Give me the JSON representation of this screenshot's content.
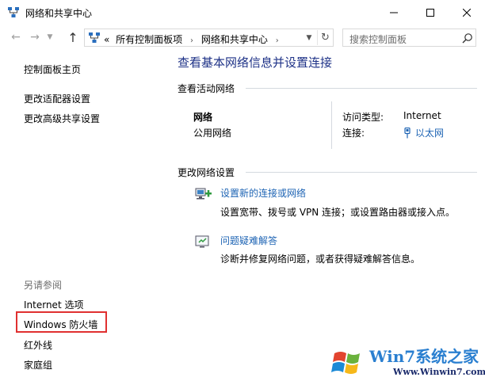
{
  "window": {
    "title": "网络和共享中心"
  },
  "address_bar": {
    "overflow": "«",
    "crumbs": [
      "所有控制面板项",
      "网络和共享中心"
    ],
    "search_placeholder": "搜索控制面板"
  },
  "left_pane": {
    "links": [
      "控制面板主页",
      "更改适配器设置",
      "更改高级共享设置"
    ],
    "see_also_header": "另请参阅",
    "see_also_links": [
      "Internet 选项",
      "Windows 防火墙",
      "红外线",
      "家庭组"
    ]
  },
  "main": {
    "title": "查看基本网络信息并设置连接",
    "active_networks": {
      "header": "查看活动网络",
      "network_name": "网络",
      "network_type": "公用网络",
      "access_type_label": "访问类型:",
      "access_type_value": "Internet",
      "connections_label": "连接:",
      "connection_name": "以太网"
    },
    "change_settings": {
      "header": "更改网络设置",
      "tasks": [
        {
          "link": "设置新的连接或网络",
          "desc": "设置宽带、拨号或 VPN 连接；或设置路由器或接入点。"
        },
        {
          "link": "问题疑难解答",
          "desc": "诊断并修复网络问题，或者获得疑难解答信息。"
        }
      ]
    }
  },
  "watermark": {
    "logo_text": "Win7系统之家",
    "url": "Www.Winwin7.com"
  },
  "colors": {
    "link": "#1e64b4",
    "title": "#1e3287",
    "highlight": "#e03030"
  }
}
